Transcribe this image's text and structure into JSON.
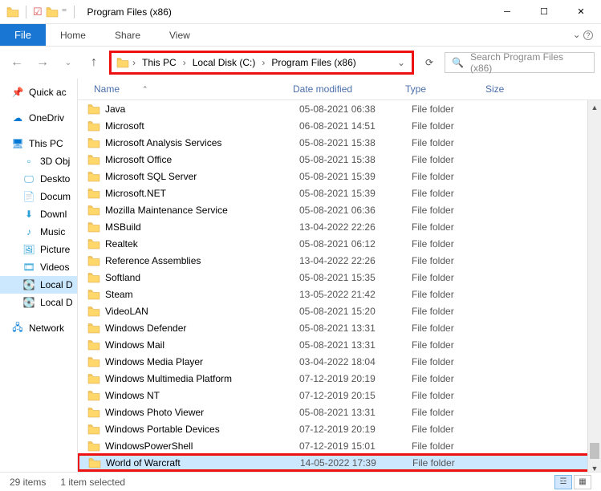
{
  "window": {
    "title": "Program Files (x86)"
  },
  "tabs": {
    "file": "File",
    "home": "Home",
    "share": "Share",
    "view": "View"
  },
  "breadcrumb": [
    "This PC",
    "Local Disk (C:)",
    "Program Files (x86)"
  ],
  "search": {
    "placeholder": "Search Program Files (x86)"
  },
  "nav": {
    "quick": "Quick ac",
    "onedrive": "OneDriv",
    "thispc": "This PC",
    "sub": [
      "3D Obj",
      "Deskto",
      "Docum",
      "Downl",
      "Music",
      "Picture",
      "Videos",
      "Local D",
      "Local D"
    ],
    "network": "Network"
  },
  "columns": {
    "name": "Name",
    "date": "Date modified",
    "type": "Type",
    "size": "Size"
  },
  "rows": [
    {
      "name": "Java",
      "date": "05-08-2021 06:38",
      "type": "File folder"
    },
    {
      "name": "Microsoft",
      "date": "06-08-2021 14:51",
      "type": "File folder"
    },
    {
      "name": "Microsoft Analysis Services",
      "date": "05-08-2021 15:38",
      "type": "File folder"
    },
    {
      "name": "Microsoft Office",
      "date": "05-08-2021 15:38",
      "type": "File folder"
    },
    {
      "name": "Microsoft SQL Server",
      "date": "05-08-2021 15:39",
      "type": "File folder"
    },
    {
      "name": "Microsoft.NET",
      "date": "05-08-2021 15:39",
      "type": "File folder"
    },
    {
      "name": "Mozilla Maintenance Service",
      "date": "05-08-2021 06:36",
      "type": "File folder"
    },
    {
      "name": "MSBuild",
      "date": "13-04-2022 22:26",
      "type": "File folder"
    },
    {
      "name": "Realtek",
      "date": "05-08-2021 06:12",
      "type": "File folder"
    },
    {
      "name": "Reference Assemblies",
      "date": "13-04-2022 22:26",
      "type": "File folder"
    },
    {
      "name": "Softland",
      "date": "05-08-2021 15:35",
      "type": "File folder"
    },
    {
      "name": "Steam",
      "date": "13-05-2022 21:42",
      "type": "File folder"
    },
    {
      "name": "VideoLAN",
      "date": "05-08-2021 15:20",
      "type": "File folder"
    },
    {
      "name": "Windows Defender",
      "date": "05-08-2021 13:31",
      "type": "File folder"
    },
    {
      "name": "Windows Mail",
      "date": "05-08-2021 13:31",
      "type": "File folder"
    },
    {
      "name": "Windows Media Player",
      "date": "03-04-2022 18:04",
      "type": "File folder"
    },
    {
      "name": "Windows Multimedia Platform",
      "date": "07-12-2019 20:19",
      "type": "File folder"
    },
    {
      "name": "Windows NT",
      "date": "07-12-2019 20:15",
      "type": "File folder"
    },
    {
      "name": "Windows Photo Viewer",
      "date": "05-08-2021 13:31",
      "type": "File folder"
    },
    {
      "name": "Windows Portable Devices",
      "date": "07-12-2019 20:19",
      "type": "File folder"
    },
    {
      "name": "WindowsPowerShell",
      "date": "07-12-2019 15:01",
      "type": "File folder"
    },
    {
      "name": "World of Warcraft",
      "date": "14-05-2022 17:39",
      "type": "File folder",
      "selected": true,
      "highlight": true
    }
  ],
  "status": {
    "count": "29 items",
    "selected": "1 item selected"
  }
}
